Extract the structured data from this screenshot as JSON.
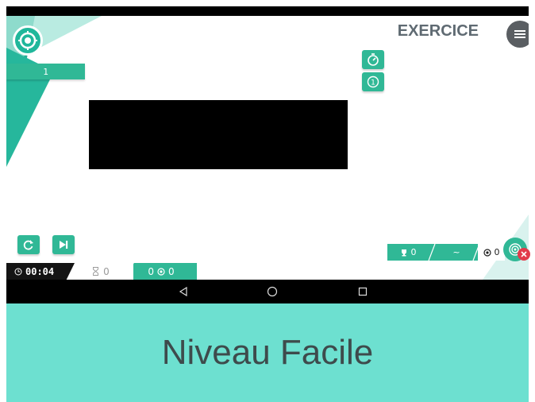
{
  "app": {
    "title": "EXERCICE",
    "level_indicator": "1",
    "icons": {
      "logo": "target-icon",
      "menu": "hamburger-menu-icon",
      "timer": "timer-icon",
      "count": "number-one-icon",
      "retry": "refresh-icon",
      "next": "skip-next-icon",
      "help": "target-help-icon",
      "close": "close-icon"
    }
  },
  "scores": {
    "trophy_value": "0",
    "wave_value": "~",
    "target_value": "0"
  },
  "bottom_bar": {
    "time": "00:04",
    "hourglass_value": "0",
    "right_value": "0",
    "right_value2": "0"
  },
  "caption": "Niveau Facile",
  "colors": {
    "primary": "#30b896",
    "dark": "#5a5e62",
    "caption_bg": "#6de0d0",
    "alert": "#e23b4b"
  }
}
